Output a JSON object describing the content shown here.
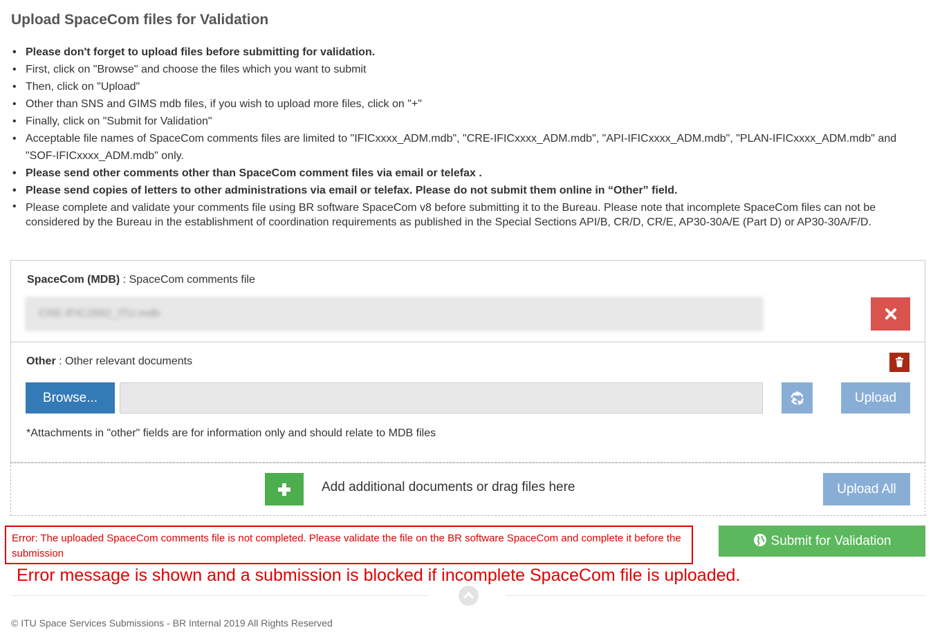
{
  "page": {
    "title": "Upload SpaceCom files for Validation"
  },
  "instructions": [
    "Please don't forget to upload files before submitting for validation.",
    "First, click on \"Browse\" and choose the files which you want to submit",
    "Then, click on \"Upload\"",
    "Other than SNS and GIMS mdb files, if you wish to upload more files, click on \"+\"",
    "Finally, click on \"Submit for Validation\"",
    "Acceptable file names of SpaceCom comments files are limited to \"IFICxxxx_ADM.mdb\", \"CRE-IFICxxxx_ADM.mdb\", \"API-IFICxxxx_ADM.mdb\", \"PLAN-IFICxxxx_ADM.mdb\" and \"SOF-IFICxxxx_ADM.mdb\" only.",
    "Please send other comments other than SpaceCom comment files via email or telefax .",
    "Please send copies of letters to other administrations via email or telefax. Please do not submit them online in “Other” field.",
    "Please complete and validate your comments file using BR software SpaceCom v8 before submitting it to the Bureau. Please note that incomplete SpaceCom files can not be considered by the Bureau in the establishment of coordination requirements as published in the Special Sections API/B, CR/D, CR/E, AP30-30A/E (Part D) or AP30-30A/F/D."
  ],
  "mdb_section": {
    "label_bold": "SpaceCom (MDB)",
    "label_rest": " : SpaceCom comments file",
    "file_name": "CRE-IFIC2892_ITU.mdb",
    "remove_icon": "close-icon"
  },
  "other_section": {
    "label_bold": "Other",
    "label_rest": " : Other relevant documents",
    "browse_label": "Browse...",
    "file_value": "",
    "upload_label": "Upload",
    "note": "*Attachments in \"other\" fields are for information only and should relate to MDB files"
  },
  "drop_zone": {
    "text": "Add additional documents or drag files here",
    "upload_all_label": "Upload All"
  },
  "error": {
    "message": "Error: The uploaded SpaceCom comments file is not completed. Please validate the file on the BR software SpaceCom and complete it before the submission"
  },
  "submit": {
    "label": "Submit for Validation"
  },
  "annotation": "Error message is shown and a submission is blocked if incomplete SpaceCom file is uploaded.",
  "footer": {
    "copyright": "© ITU Space Services Submissions - BR Internal 2019 All Rights Reserved"
  },
  "colors": {
    "primary": "#337ab7",
    "disabled_primary": "#89aed6",
    "danger": "#d9534f",
    "dark_danger": "#a82a16",
    "success": "#5cb85c",
    "add_green": "#4cae4c",
    "error_red": "#e00000"
  }
}
